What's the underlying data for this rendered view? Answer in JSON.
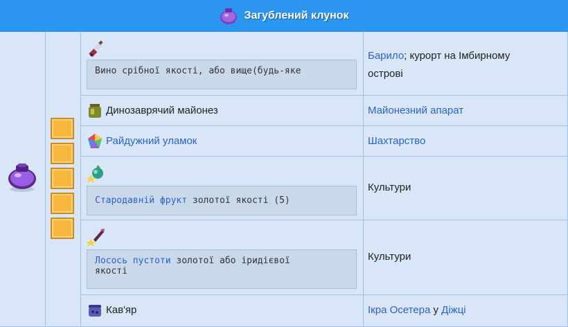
{
  "header": {
    "title": "Загублений клунок",
    "icon": "purple-bag-icon"
  },
  "bag": {
    "icon": "purple-bag-icon",
    "slots": 5,
    "slot_color": "#f7b63d"
  },
  "rows": [
    {
      "item_icon": "wine-bottle-icon",
      "note": "Вино срібної якості, або вище(будь-яке",
      "source_link": "Барило",
      "source_rest": "; курорт на Імбирному",
      "source_rest2": "острові"
    },
    {
      "item_icon": "mayonnaise-jar-icon",
      "name": "Динозаврячий майонез",
      "source_link": "Майонезний апарат"
    },
    {
      "item_icon": "prismatic-shard-icon",
      "name": "Райдужний уламок",
      "source_link": "Шахтарство"
    },
    {
      "item_icon": "ancient-fruit-icon",
      "note_link": "Стародавній фрукт",
      "note_rest": " золотої якості (5)",
      "source": "Культури"
    },
    {
      "item_icon": "void-salmon-icon",
      "note_link": "Лосось пустоти",
      "note_rest": " золотої або іридієвої",
      "note_rest2": "якості",
      "source": "Культури"
    },
    {
      "item_icon": "caviar-icon",
      "name": "Кав'яр",
      "source_link": "Ікра Осетера",
      "source_mid": " у ",
      "source_link2": "Діжці"
    }
  ],
  "colors": {
    "header": "#2b95f0",
    "cell": "#d8e6f7",
    "border": "#9fc3e8",
    "link": "#2a62c9"
  }
}
